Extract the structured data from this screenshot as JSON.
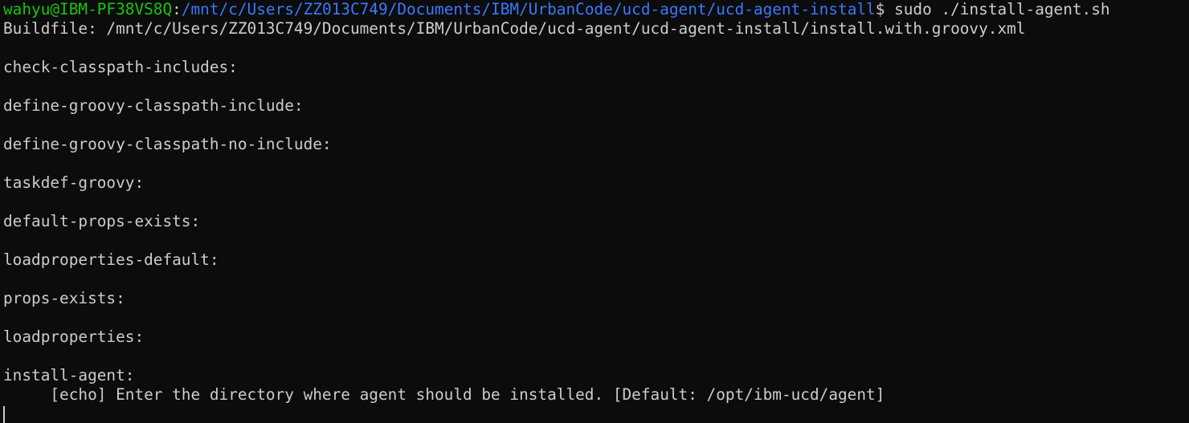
{
  "terminal": {
    "prompt_user": "wahyu@IBM-PF38VS8Q",
    "prompt_sep": ":",
    "prompt_path": "/mnt/c/Users/ZZ013C749/Documents/IBM/UrbanCode/ucd-agent/ucd-agent-install",
    "prompt_symbol": "$ ",
    "command": "sudo ./install-agent.sh",
    "lines": [
      "Buildfile: /mnt/c/Users/ZZ013C749/Documents/IBM/UrbanCode/ucd-agent/ucd-agent-install/install.with.groovy.xml",
      "",
      "check-classpath-includes:",
      "",
      "define-groovy-classpath-include:",
      "",
      "define-groovy-classpath-no-include:",
      "",
      "taskdef-groovy:",
      "",
      "default-props-exists:",
      "",
      "loadproperties-default:",
      "",
      "props-exists:",
      "",
      "loadproperties:",
      "",
      "install-agent:",
      "     [echo] Enter the directory where agent should be installed. [Default: /opt/ibm-ucd/agent]"
    ],
    "colors": {
      "background": "#0c0c0c",
      "text": "#cccccc",
      "user": "#16c60c",
      "path": "#3b78ff"
    }
  }
}
